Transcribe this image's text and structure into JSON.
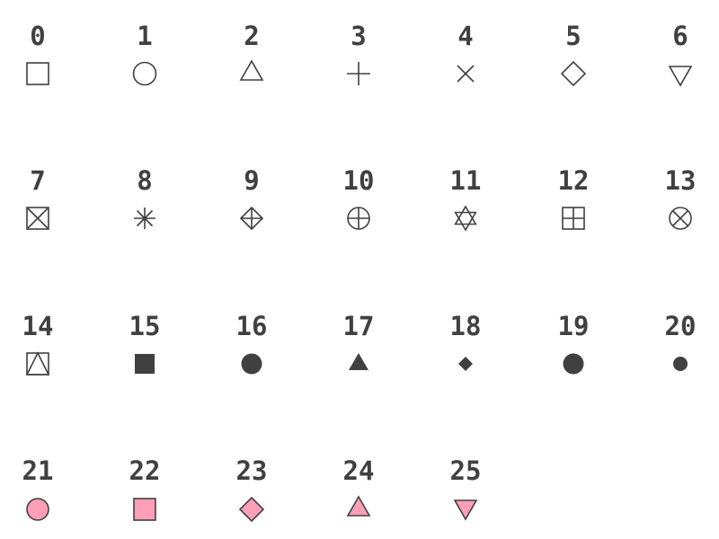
{
  "colors": {
    "stroke": "#404040",
    "solid_fill": "#404040",
    "accent_fill": "#ff9fb7",
    "label": "#404040",
    "background": "#ffffff"
  },
  "shapes": [
    {
      "code": "0",
      "icon": "open-square-icon"
    },
    {
      "code": "1",
      "icon": "open-circle-icon"
    },
    {
      "code": "2",
      "icon": "open-triangle-icon"
    },
    {
      "code": "3",
      "icon": "plus-icon"
    },
    {
      "code": "4",
      "icon": "cross-icon"
    },
    {
      "code": "5",
      "icon": "open-diamond-icon"
    },
    {
      "code": "6",
      "icon": "open-down-triangle-icon"
    },
    {
      "code": "7",
      "icon": "square-cross-icon"
    },
    {
      "code": "8",
      "icon": "asterisk-icon"
    },
    {
      "code": "9",
      "icon": "diamond-plus-icon"
    },
    {
      "code": "10",
      "icon": "circle-plus-icon"
    },
    {
      "code": "11",
      "icon": "star-of-david-icon"
    },
    {
      "code": "12",
      "icon": "square-plus-icon"
    },
    {
      "code": "13",
      "icon": "circle-cross-icon"
    },
    {
      "code": "14",
      "icon": "square-triangle-icon"
    },
    {
      "code": "15",
      "icon": "filled-square-icon"
    },
    {
      "code": "16",
      "icon": "filled-circle-icon"
    },
    {
      "code": "17",
      "icon": "filled-triangle-icon"
    },
    {
      "code": "18",
      "icon": "filled-small-diamond-icon"
    },
    {
      "code": "19",
      "icon": "filled-large-circle-icon"
    },
    {
      "code": "20",
      "icon": "filled-small-circle-icon"
    },
    {
      "code": "21",
      "icon": "pink-circle-icon"
    },
    {
      "code": "22",
      "icon": "pink-square-icon"
    },
    {
      "code": "23",
      "icon": "pink-diamond-icon"
    },
    {
      "code": "24",
      "icon": "pink-triangle-icon"
    },
    {
      "code": "25",
      "icon": "pink-down-triangle-icon"
    }
  ]
}
